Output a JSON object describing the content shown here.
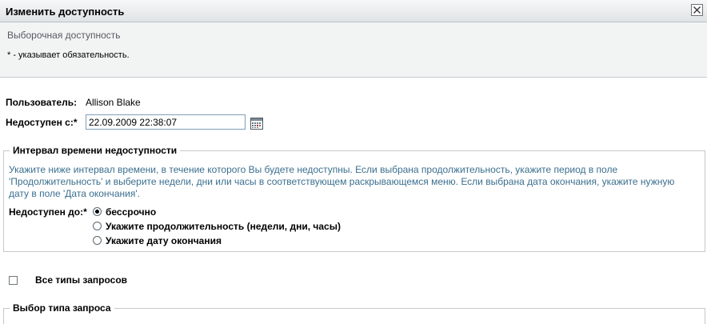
{
  "dialog": {
    "title": "Изменить доступность",
    "subtitle": "Выборочная доступность",
    "required_note": "* - указывает обязательность."
  },
  "form": {
    "user_label": "Пользователь:",
    "user_value": "Allison Blake",
    "unavailable_from_label": "Недоступен с:*",
    "unavailable_from_value": "22.09.2009 22:38:07"
  },
  "interval": {
    "legend": "Интервал времени недоступности",
    "description": "Укажите ниже интервал времени, в течение которого Вы будете недоступны. Если выбрана продолжительность, укажите период в поле 'Продолжительность' и выберите недели, дни или часы в соответствующем раскрывающемся меню. Если выбрана дата окончания, укажите нужную дату в поле 'Дата окончания'.",
    "until_label": "Недоступен до:*",
    "options": [
      {
        "label": "бессрочно",
        "selected": true
      },
      {
        "label": "Укажите продолжительность (недели, дни, часы)",
        "selected": false
      },
      {
        "label": "Укажите дату окончания",
        "selected": false
      }
    ]
  },
  "all_request_types": {
    "label": "Все типы запросов",
    "checked": false
  },
  "request_type_section": {
    "legend": "Выбор типа запроса"
  },
  "icons": {
    "close": "close-icon",
    "calendar": "calendar-icon"
  }
}
